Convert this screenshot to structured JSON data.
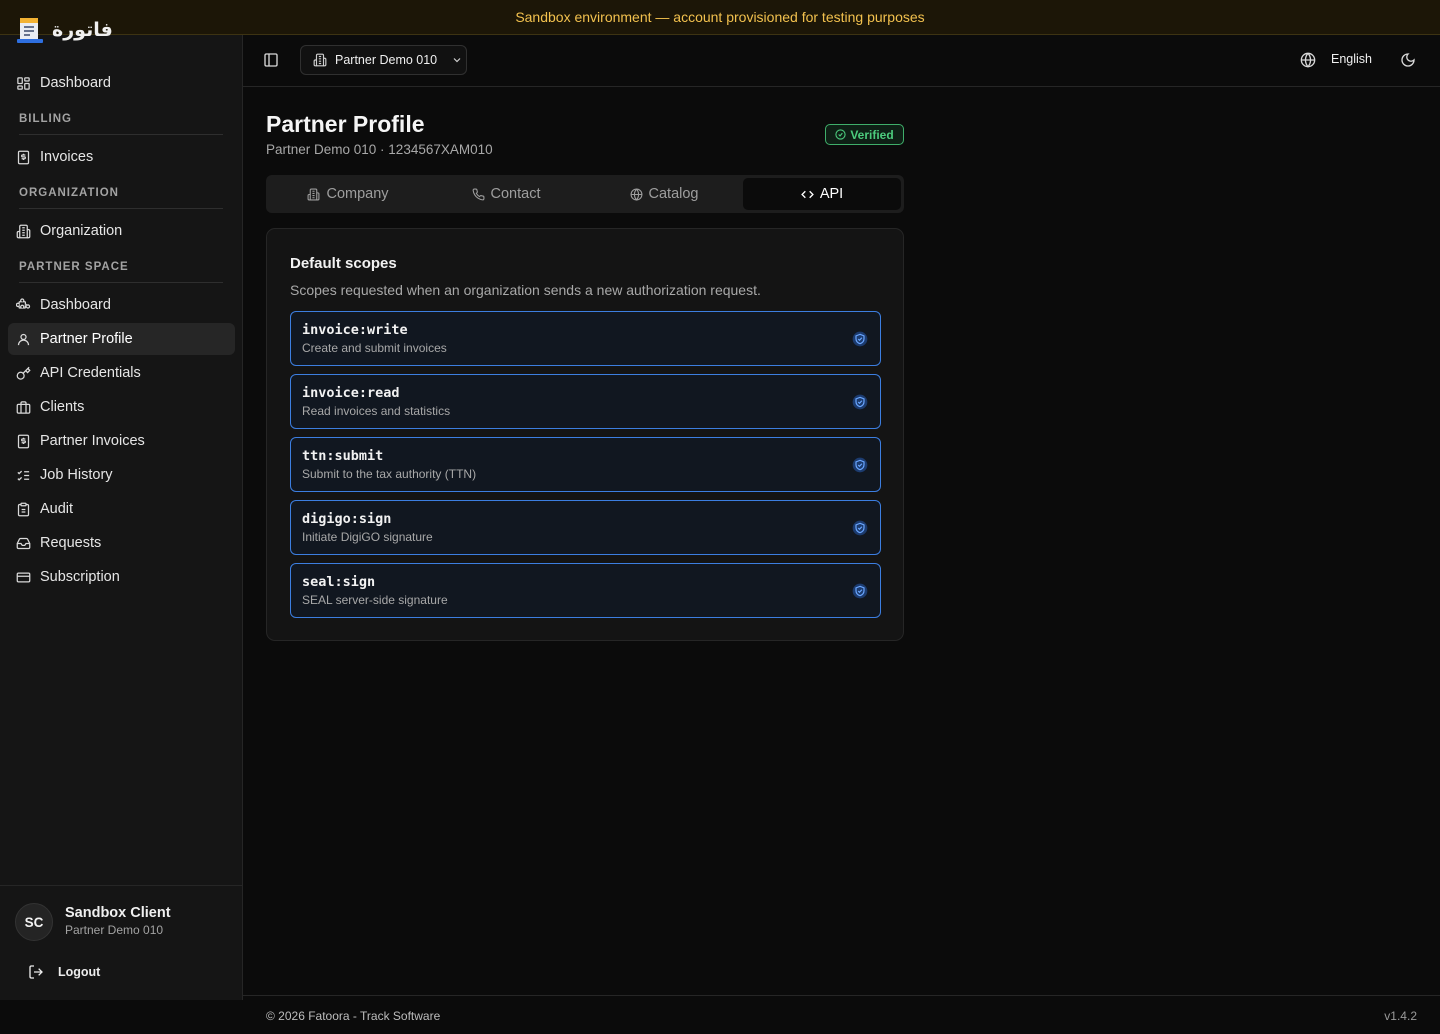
{
  "banner": {
    "text": "Sandbox environment — account provisioned for testing purposes"
  },
  "brand": {
    "name": "فاتورة"
  },
  "sidebar": {
    "dashboard": "Dashboard",
    "billing_section": "BILLING",
    "invoices": "Invoices",
    "organization_section": "ORGANIZATION",
    "organization": "Organization",
    "partner_section": "PARTNER SPACE",
    "partner_dashboard": "Dashboard",
    "partner_profile": "Partner Profile",
    "api_credentials": "API Credentials",
    "clients": "Clients",
    "partner_invoices": "Partner Invoices",
    "job_history": "Job History",
    "audit": "Audit",
    "requests": "Requests",
    "subscription": "Subscription",
    "active_item": "Partner Profile"
  },
  "user": {
    "initials": "SC",
    "name": "Sandbox Client",
    "org": "Partner Demo 010",
    "logout": "Logout"
  },
  "topbar": {
    "org_selected": "Partner Demo 010",
    "language": "English"
  },
  "page": {
    "title": "Partner Profile",
    "subtitle": "Partner Demo 010 · 1234567XAM010",
    "badge": "Verified"
  },
  "tabs": {
    "company": "Company",
    "contact": "Contact",
    "catalog": "Catalog",
    "api": "API",
    "active": "API"
  },
  "scopes_card": {
    "title": "Default scopes",
    "description": "Scopes requested when an organization sends a new authorization request.",
    "items": [
      {
        "name": "invoice:write",
        "desc": "Create and submit invoices"
      },
      {
        "name": "invoice:read",
        "desc": "Read invoices and statistics"
      },
      {
        "name": "ttn:submit",
        "desc": "Submit to the tax authority (TTN)"
      },
      {
        "name": "digigo:sign",
        "desc": "Initiate DigiGO signature"
      },
      {
        "name": "seal:sign",
        "desc": "SEAL server-side signature"
      }
    ]
  },
  "footer": {
    "copyright": "© 2026 Fatoora - Track Software",
    "version": "v1.4.2"
  },
  "colors": {
    "accent_blue": "#3c7ee0",
    "verified_green": "#4ccb7d",
    "banner_yellow": "#f2c14e"
  },
  "icons": {
    "dashboard": "grid-icon",
    "invoices": "receipt-icon",
    "organization": "building-icon",
    "partner_dashboard": "puzzle-icon",
    "partner_profile": "user-icon",
    "api_credentials": "key-icon",
    "clients": "briefcase-icon",
    "partner_invoices": "receipt-icon",
    "job_history": "list-checks-icon",
    "audit": "clipboard-icon",
    "requests": "inbox-icon",
    "subscription": "credit-card-icon"
  }
}
